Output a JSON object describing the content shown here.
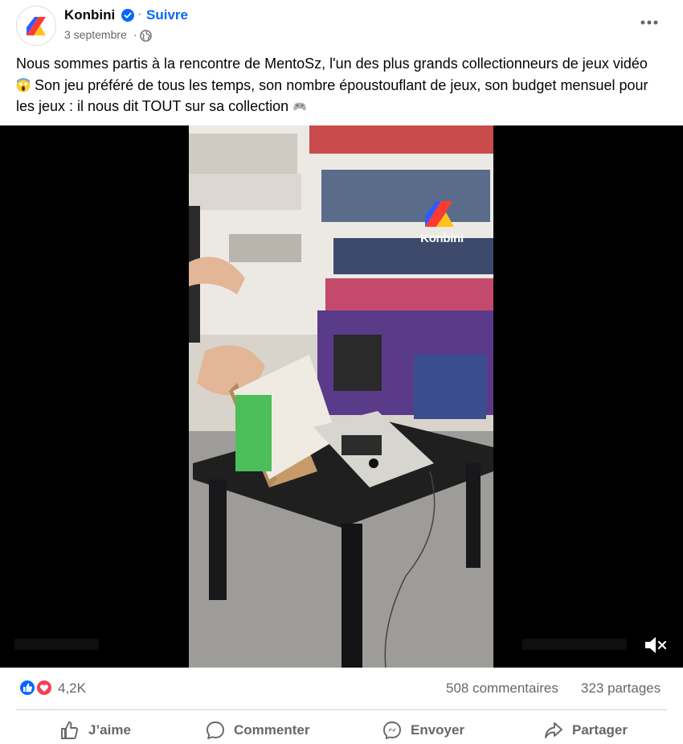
{
  "post": {
    "page_name": "Konbini",
    "follow_label": "Suivre",
    "date": "3 septembre",
    "text_line1": "Nous sommes partis à la rencontre de MentoSz, l'un des plus grands collectionneurs de jeux vidéo",
    "text_line2": "Son jeu préféré de tous les temps, son nombre époustouflant de jeux, son budget mensuel pour les jeux : il nous dit TOUT sur sa collection",
    "video_watermark": "Konbini"
  },
  "stats": {
    "reactions_count": "4,2K",
    "comments": "508 commentaires",
    "shares": "323 partages"
  },
  "actions": {
    "like": "J’aime",
    "comment": "Commenter",
    "send": "Envoyer",
    "share": "Partager"
  },
  "icons": {
    "verified": "verified-badge-icon",
    "globe": "globe-icon",
    "more": "more-options-icon",
    "mute": "speaker-muted-icon",
    "like_reaction": "like-reaction-icon",
    "love_reaction": "love-reaction-icon"
  },
  "colors": {
    "brand_blue": "#0866ff",
    "secondary_text": "#65676b",
    "love_red": "#f33e58"
  }
}
